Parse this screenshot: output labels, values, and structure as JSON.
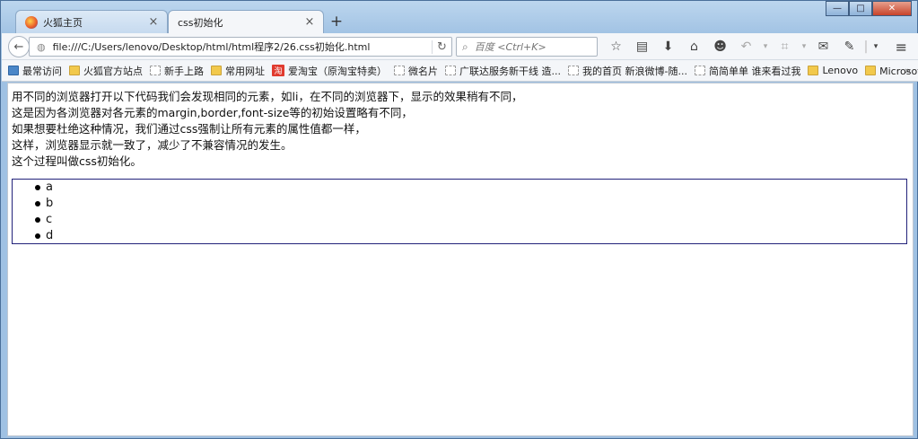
{
  "window_controls": {
    "minimize": "—",
    "maximize": "□",
    "close": "✕"
  },
  "tabs": [
    {
      "title": "火狐主页",
      "active": false,
      "close": "×"
    },
    {
      "title": "css初始化",
      "active": true,
      "close": "×"
    }
  ],
  "new_tab": "+",
  "navbar": {
    "back": "←",
    "url": "file:///C:/Users/lenovo/Desktop/html/html程序2/26.css初始化.html",
    "reload": "↻",
    "search_placeholder": "百度 <Ctrl+K>",
    "toolbar_icons": [
      "star-icon",
      "reading-list-icon",
      "download-icon",
      "home-icon",
      "chat-icon",
      "undo-icon",
      "dropdown-icon",
      "crop-icon",
      "dropdown-icon",
      "comment-icon",
      "tools-icon",
      "dropdown-icon"
    ],
    "menu": "≡"
  },
  "bookmarks": [
    {
      "label": "最常访问",
      "icon": "star"
    },
    {
      "label": "火狐官方站点",
      "icon": "folder"
    },
    {
      "label": "新手上路",
      "icon": "page"
    },
    {
      "label": "常用网址",
      "icon": "folder"
    },
    {
      "label": "爱淘宝（原淘宝特卖）",
      "icon": "taobao",
      "icon_text": "淘"
    },
    {
      "label": "微名片",
      "icon": "page"
    },
    {
      "label": "广联达服务新干线 造...",
      "icon": "page"
    },
    {
      "label": "我的首页 新浪微博-随...",
      "icon": "page"
    },
    {
      "label": "简简单单 谁来看过我",
      "icon": "page"
    },
    {
      "label": "Lenovo",
      "icon": "folder"
    },
    {
      "label": "Microsoft 网站",
      "icon": "folder"
    }
  ],
  "bookmarks_overflow": "»",
  "page": {
    "lines": [
      "用不同的浏览器打开以下代码我们会发现相同的元素，如li，在不同的浏览器下，显示的效果稍有不同，",
      "这是因为各浏览器对各元素的margin,border,font-size等的初始设置略有不同，",
      "如果想要杜绝这种情况，我们通过css强制让所有元素的属性值都一样，",
      "这样，浏览器显示就一致了，减少了不兼容情况的发生。",
      "这个过程叫做css初始化。"
    ],
    "list_items": [
      "a",
      "b",
      "c",
      "d"
    ]
  }
}
